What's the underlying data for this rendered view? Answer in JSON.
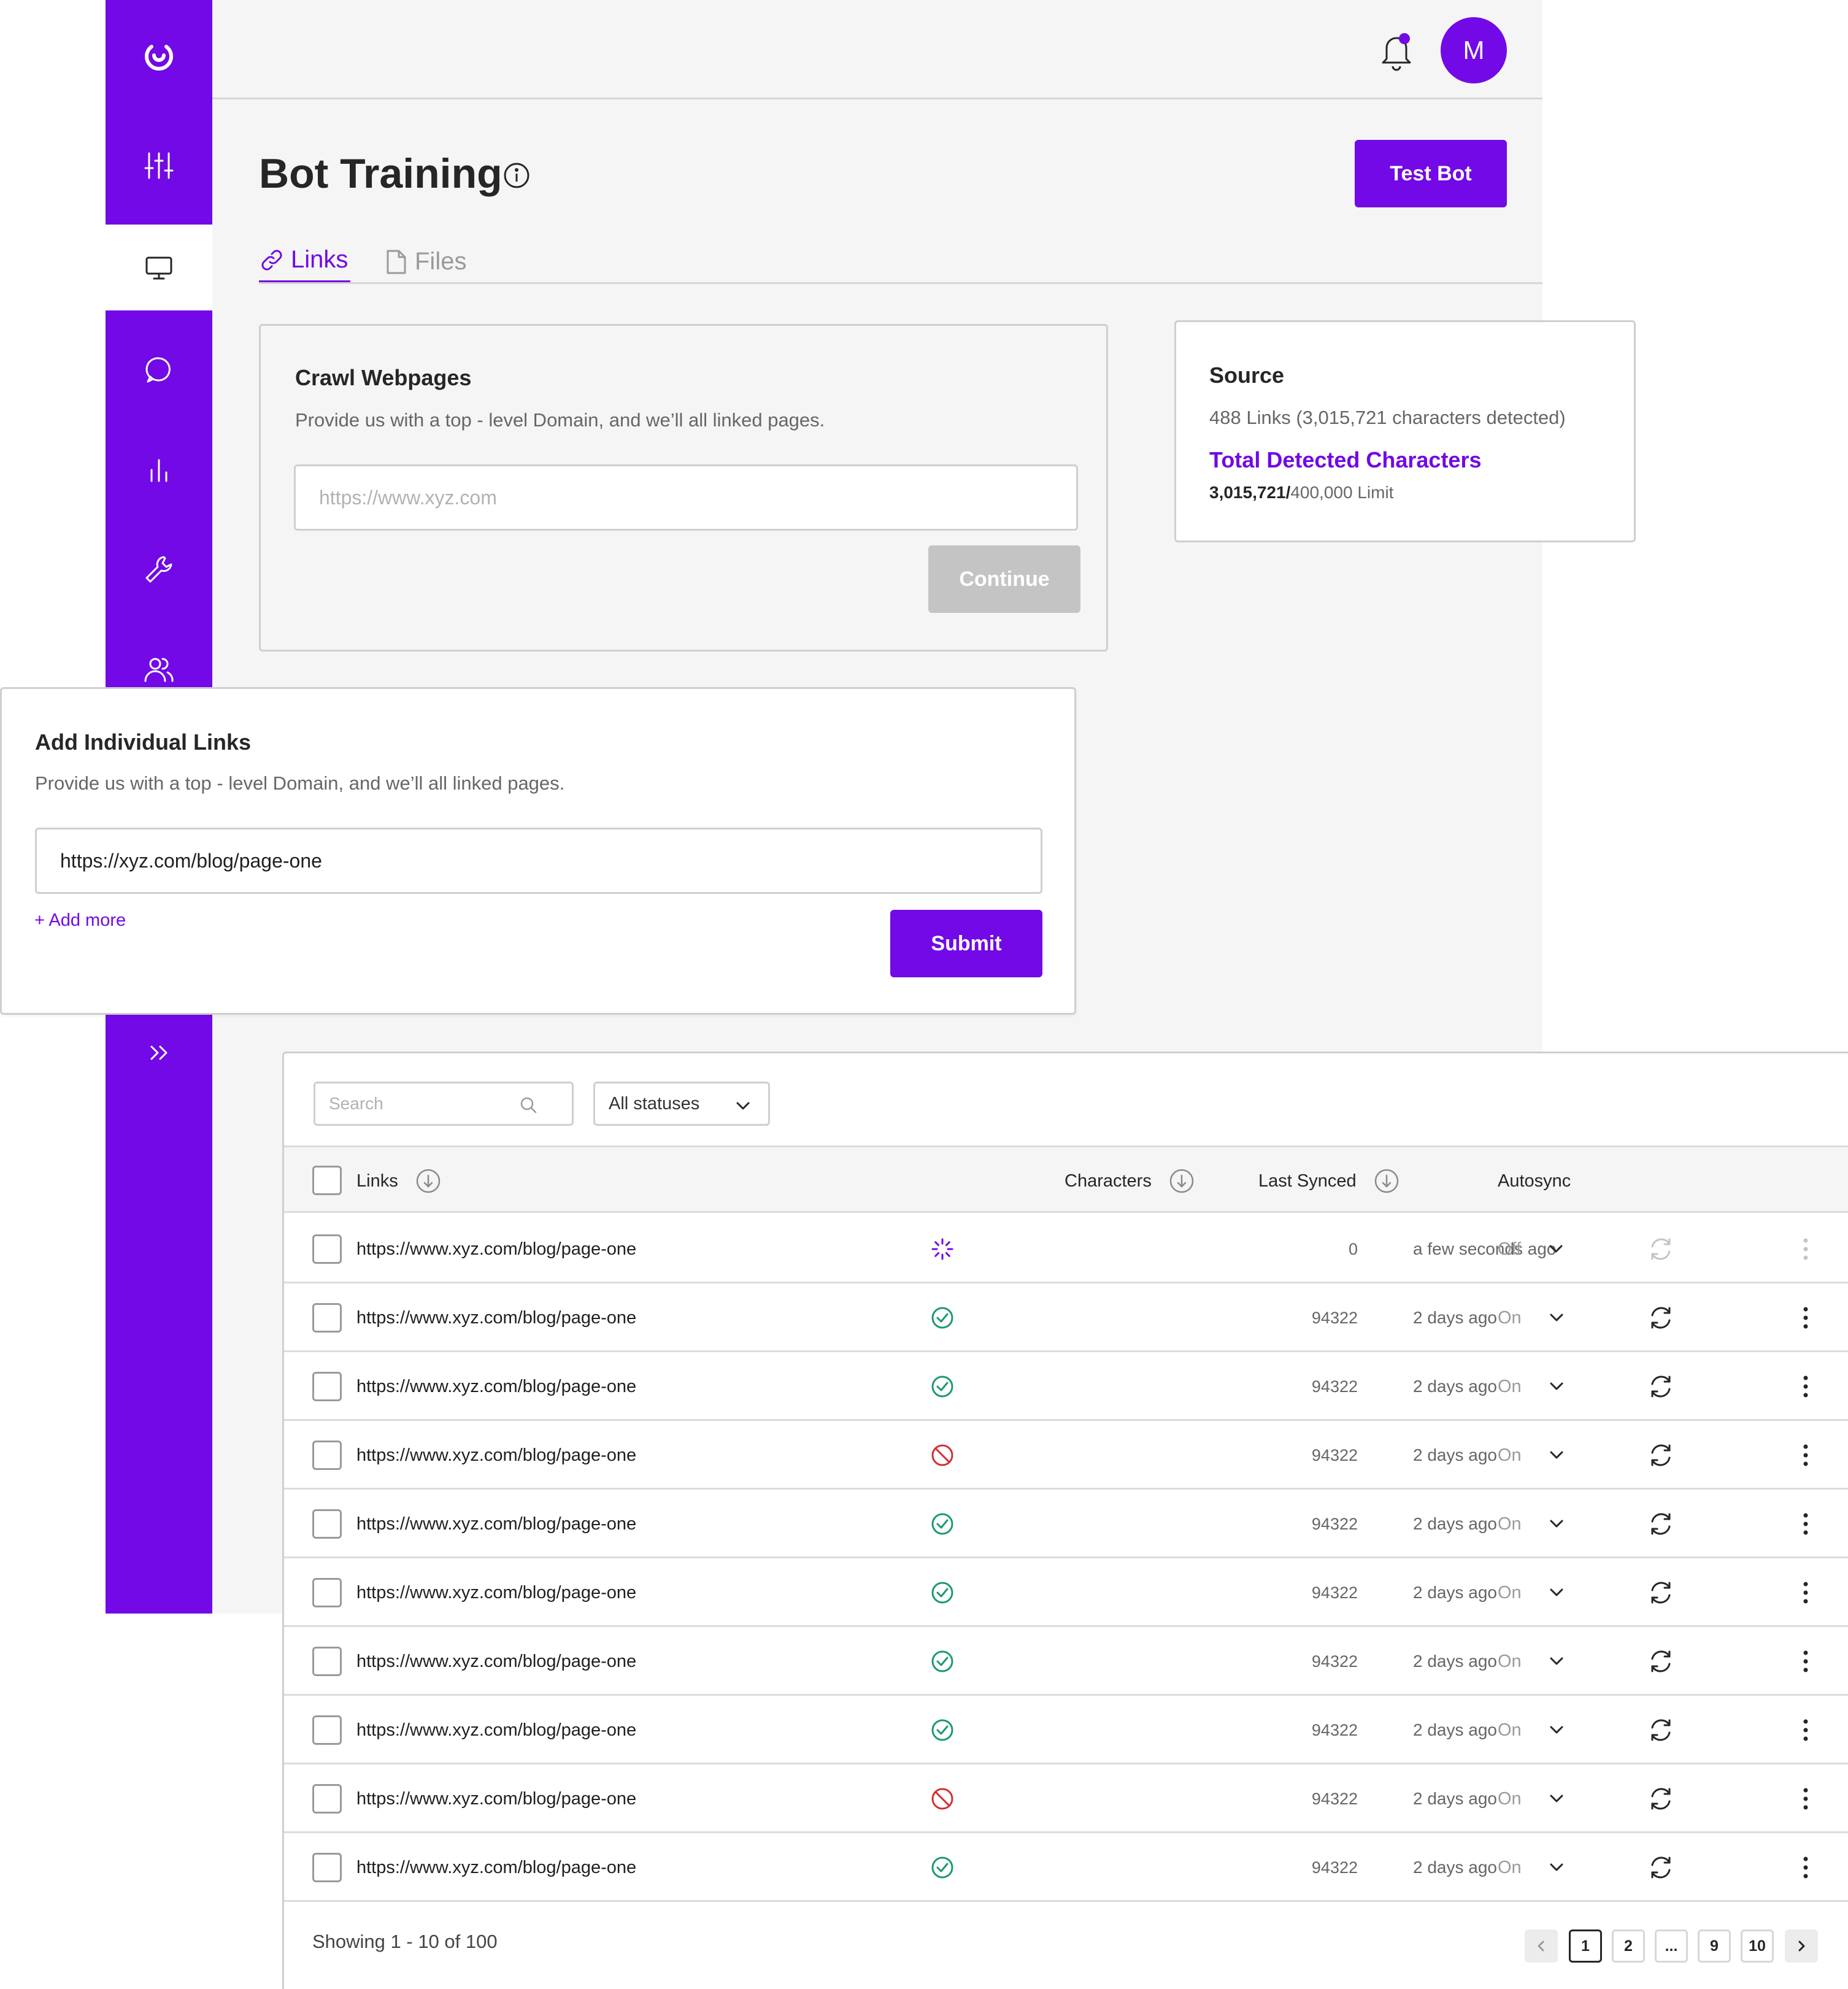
{
  "page": {
    "title": "Bot Training",
    "test_bot_label": "Test Bot",
    "avatar_initial": "M"
  },
  "tabs": [
    {
      "label": "Links",
      "active": true
    },
    {
      "label": "Files",
      "active": false
    }
  ],
  "crawl": {
    "title": "Crawl Webpages",
    "description": "Provide us with a top - level Domain, and we’ll all linked pages.",
    "placeholder": "https://www.xyz.com",
    "continue_label": "Continue"
  },
  "source": {
    "title": "Source",
    "summary": "488 Links (3,015,721 characters detected)",
    "total_label": "Total Detected Characters",
    "detected": "3,015,721/",
    "limit": "400,000 Limit"
  },
  "individual": {
    "title": "Add Individual Links",
    "description": "Provide us with a top - level Domain, and we’ll all linked pages.",
    "value": "https://xyz.com/blog/page-one",
    "add_more_label": "+ Add more",
    "submit_label": "Submit"
  },
  "table": {
    "search_placeholder": "Search",
    "status_filter": "All statuses",
    "columns": {
      "links": "Links",
      "characters": "Characters",
      "last_synced": "Last Synced",
      "autosync": "Autosync"
    },
    "rows": [
      {
        "link": "https://www.xyz.com/blog/page-one",
        "status": "loading",
        "characters": "0",
        "last_synced": "a few seconds ago",
        "autosync": "Off"
      },
      {
        "link": "https://www.xyz.com/blog/page-one",
        "status": "success",
        "characters": "94322",
        "last_synced": "2 days ago",
        "autosync": "On"
      },
      {
        "link": "https://www.xyz.com/blog/page-one",
        "status": "success",
        "characters": "94322",
        "last_synced": "2 days ago",
        "autosync": "On"
      },
      {
        "link": "https://www.xyz.com/blog/page-one",
        "status": "blocked",
        "characters": "94322",
        "last_synced": "2 days ago",
        "autosync": "On"
      },
      {
        "link": "https://www.xyz.com/blog/page-one",
        "status": "success",
        "characters": "94322",
        "last_synced": "2 days ago",
        "autosync": "On"
      },
      {
        "link": "https://www.xyz.com/blog/page-one",
        "status": "success",
        "characters": "94322",
        "last_synced": "2 days ago",
        "autosync": "On"
      },
      {
        "link": "https://www.xyz.com/blog/page-one",
        "status": "success",
        "characters": "94322",
        "last_synced": "2 days ago",
        "autosync": "On"
      },
      {
        "link": "https://www.xyz.com/blog/page-one",
        "status": "success",
        "characters": "94322",
        "last_synced": "2 days ago",
        "autosync": "On"
      },
      {
        "link": "https://www.xyz.com/blog/page-one",
        "status": "blocked",
        "characters": "94322",
        "last_synced": "2 days ago",
        "autosync": "On"
      },
      {
        "link": "https://www.xyz.com/blog/page-one",
        "status": "success",
        "characters": "94322",
        "last_synced": "2 days ago",
        "autosync": "On"
      }
    ],
    "showing": "Showing 1 - 10 of 100",
    "pages": [
      "1",
      "2",
      "...",
      "9",
      "10"
    ],
    "current_page": "1"
  },
  "sidebar": {
    "icons": [
      "logo-icon",
      "sliders-icon",
      "monitor-icon",
      "chat-icon",
      "bar-chart-icon",
      "wrench-icon",
      "users-icon",
      "expand-icon"
    ],
    "active": "monitor-icon"
  },
  "colors": {
    "brand": "#7209e6",
    "success": "#1a9a6c",
    "error": "#d32f2f",
    "disabled": "#c4c4c4"
  }
}
